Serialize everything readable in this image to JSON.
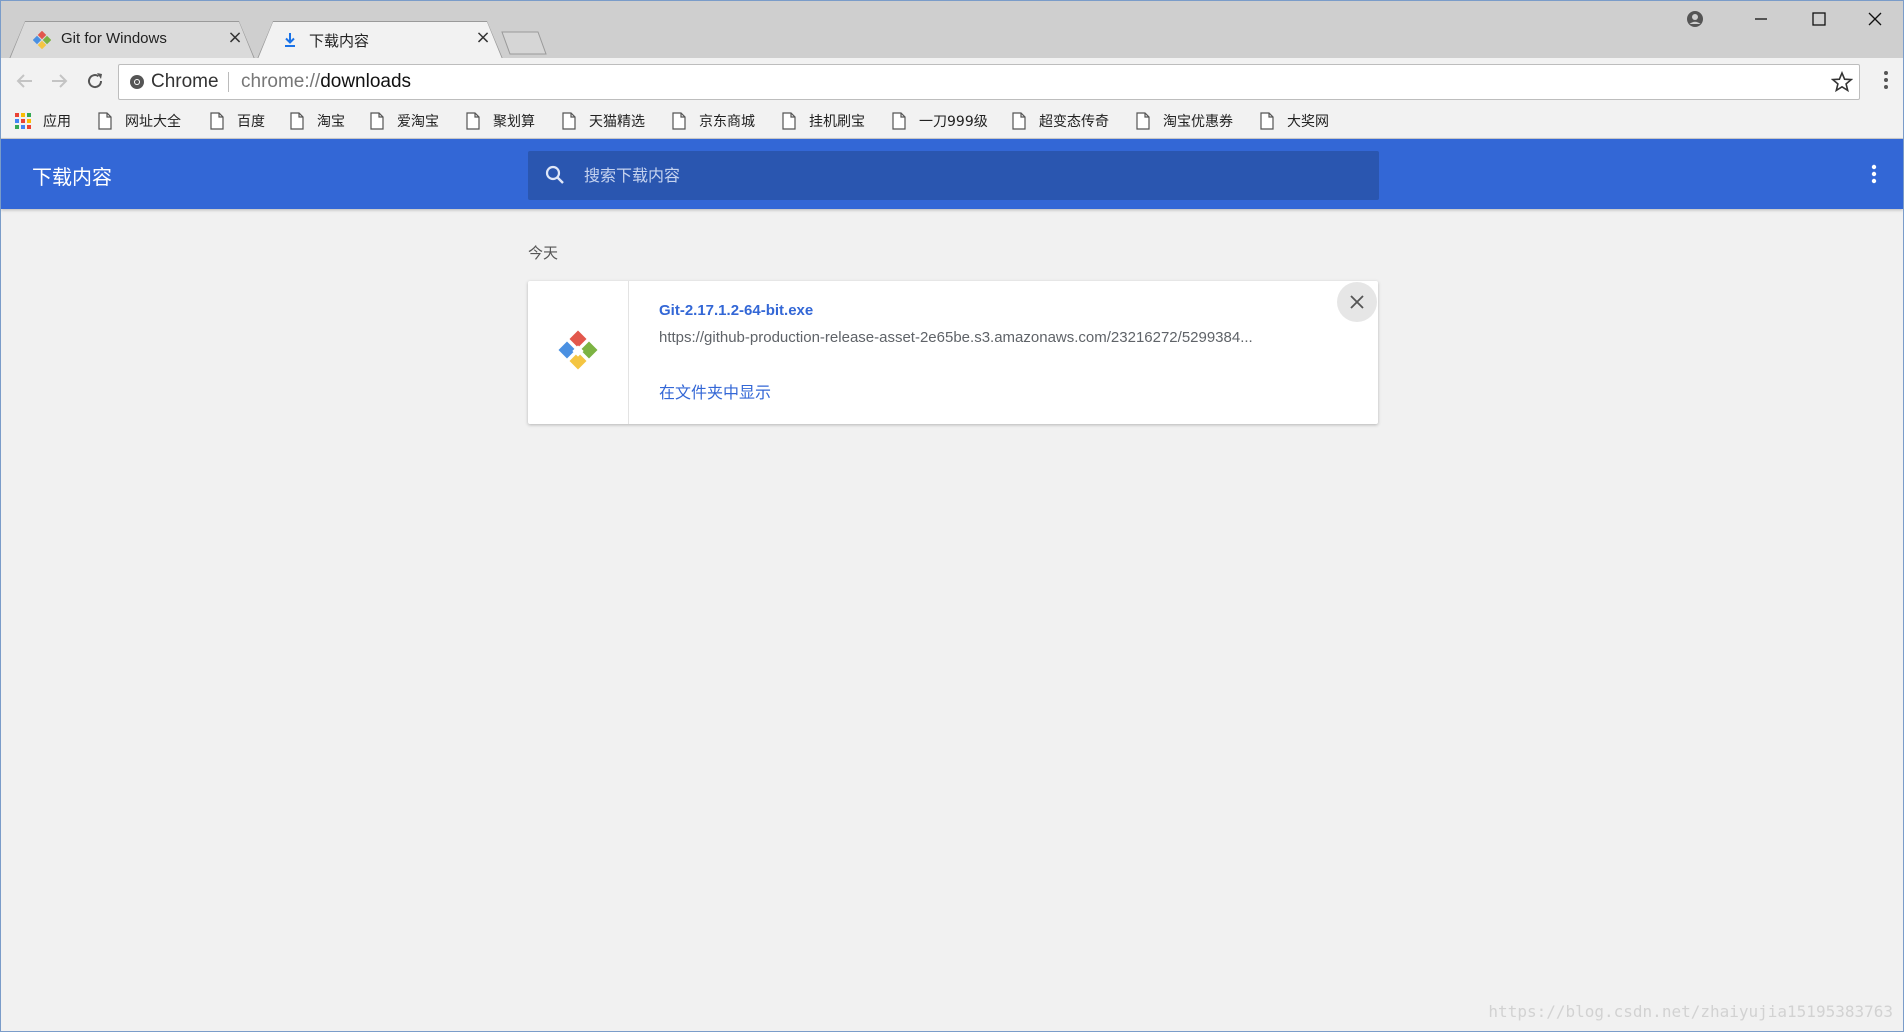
{
  "tabs": [
    {
      "title": "Git for Windows",
      "close": "×",
      "icon": "git-favicon"
    },
    {
      "title": "下载内容",
      "close": "×",
      "icon": "download-icon"
    }
  ],
  "omnibox": {
    "chip": "Chrome",
    "scheme": "chrome://",
    "host": "downloads"
  },
  "bookmarks": [
    {
      "label": "应用",
      "icon": "apps-grid-icon"
    },
    {
      "label": "网址大全",
      "icon": "page-icon"
    },
    {
      "label": "百度",
      "icon": "page-icon"
    },
    {
      "label": "淘宝",
      "icon": "page-icon"
    },
    {
      "label": "爱淘宝",
      "icon": "page-icon"
    },
    {
      "label": "聚划算",
      "icon": "page-icon"
    },
    {
      "label": "天猫精选",
      "icon": "page-icon"
    },
    {
      "label": "京东商城",
      "icon": "page-icon"
    },
    {
      "label": "挂机刷宝",
      "icon": "page-icon"
    },
    {
      "label": "一刀999级",
      "icon": "page-icon"
    },
    {
      "label": "超变态传奇",
      "icon": "page-icon"
    },
    {
      "label": "淘宝优惠券",
      "icon": "page-icon"
    },
    {
      "label": "大奖网",
      "icon": "page-icon"
    }
  ],
  "downloads": {
    "title": "下载内容",
    "search_placeholder": "搜索下载内容",
    "date_label": "今天",
    "items": [
      {
        "filename": "Git-2.17.1.2-64-bit.exe",
        "url": "https://github-production-release-asset-2e65be.s3.amazonaws.com/23216272/5299384...",
        "action": "在文件夹中显示"
      }
    ]
  },
  "watermark": "https://blog.csdn.net/zhaiyujia15195383763",
  "colors": {
    "header": "#3367d6",
    "search_bg": "#2a56b0",
    "link": "#3367d6",
    "page_bg": "#f1f1f1"
  }
}
